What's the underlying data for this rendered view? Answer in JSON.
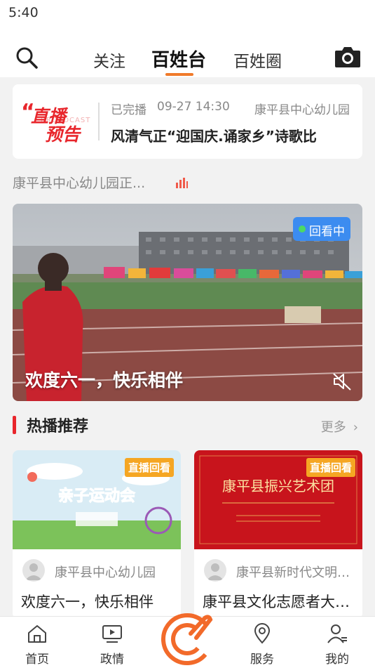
{
  "status_bar": {
    "time": "5:40"
  },
  "top_nav": {
    "tabs": [
      {
        "label": "关注",
        "active": false
      },
      {
        "label": "百姓台",
        "active": true
      },
      {
        "label": "百姓圈",
        "active": false
      }
    ],
    "search_icon": "search-icon",
    "camera_icon": "camera-icon",
    "accent": "#f07a2a"
  },
  "live_card": {
    "badge_line1": "直播",
    "badge_line2": "预告",
    "status": "已完播",
    "datetime": "09-27 14:30",
    "org": "康平县中心幼儿园",
    "title": "风清气正“迎国庆.诵家乡”诗歌比"
  },
  "channel": {
    "name": "康平县中心幼儿园正...",
    "icon": "live-bars-icon"
  },
  "featured_video": {
    "badge": "回看中",
    "title": "欢度六一，快乐相伴",
    "mute_icon": "mute-icon"
  },
  "section": {
    "title": "热播推荐",
    "more": "更多"
  },
  "recommendations": [
    {
      "badge": "直播回看",
      "thumb_text": "亲子运动会",
      "org": "康平县中心幼儿园",
      "title": "欢度六一，快乐相伴"
    },
    {
      "badge": "直播回看",
      "thumb_text": "康平县振兴艺术团",
      "org": "康平县新时代文明实践中心",
      "title": "康平县文化志愿者大联欢"
    }
  ],
  "bottom_nav": [
    {
      "label": "首页",
      "icon": "home-icon"
    },
    {
      "label": "政情",
      "icon": "tv-icon"
    },
    {
      "label": "",
      "icon": "center-logo-icon"
    },
    {
      "label": "服务",
      "icon": "location-icon"
    },
    {
      "label": "我的",
      "icon": "user-icon"
    }
  ],
  "colors": {
    "live_red": "#e8262c",
    "replay_blue": "#3c8cf0",
    "badge_orange": "#f5a623"
  }
}
